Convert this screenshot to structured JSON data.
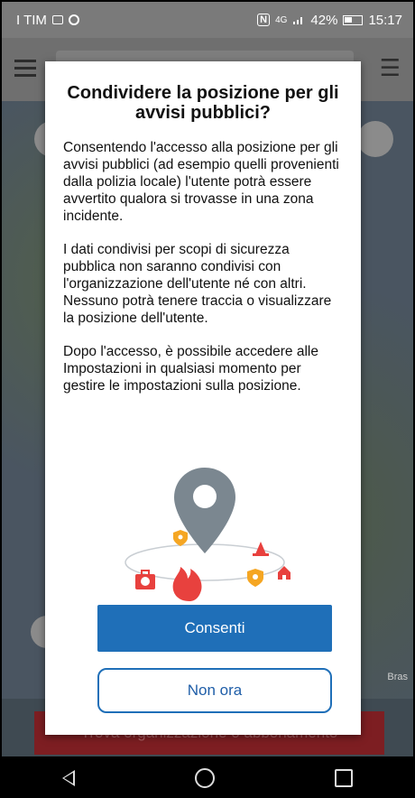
{
  "status_bar": {
    "carrier": "I TIM",
    "network": "4G",
    "battery": "42%",
    "time": "15:17"
  },
  "background": {
    "map_label": "Bras",
    "bottom_banner_label": "Trova organizzazione o abbonamento"
  },
  "dialog": {
    "title": "Condividere la posizione per gli avvisi pubblici?",
    "paragraphs": [
      "Consentendo l'accesso alla posizione per gli avvisi pubblici (ad esempio quelli provenienti dalla polizia locale) l'utente potrà essere avvertito qualora si trovasse in una zona incidente.",
      "I dati condivisi per scopi di sicurezza pubblica non saranno condivisi con l'organizzazione dell'utente né con altri. Nessuno potrà tenere traccia o visualizzare la posizione dell'utente.",
      "Dopo l'accesso, è possibile accedere alle Impostazioni in qualsiasi momento per gestire le impostazioni sulla posizione."
    ],
    "allow_label": "Consenti",
    "not_now_label": "Non ora"
  },
  "colors": {
    "primary": "#1f6fb8",
    "alert_red": "#e8413e",
    "alert_orange": "#f5a623",
    "pin_gray": "#7b8790"
  },
  "icons": {
    "illustration": "location-alerts-illustration",
    "nav_back": "back-triangle-icon",
    "nav_home": "home-circle-icon",
    "nav_recent": "recents-square-icon"
  }
}
